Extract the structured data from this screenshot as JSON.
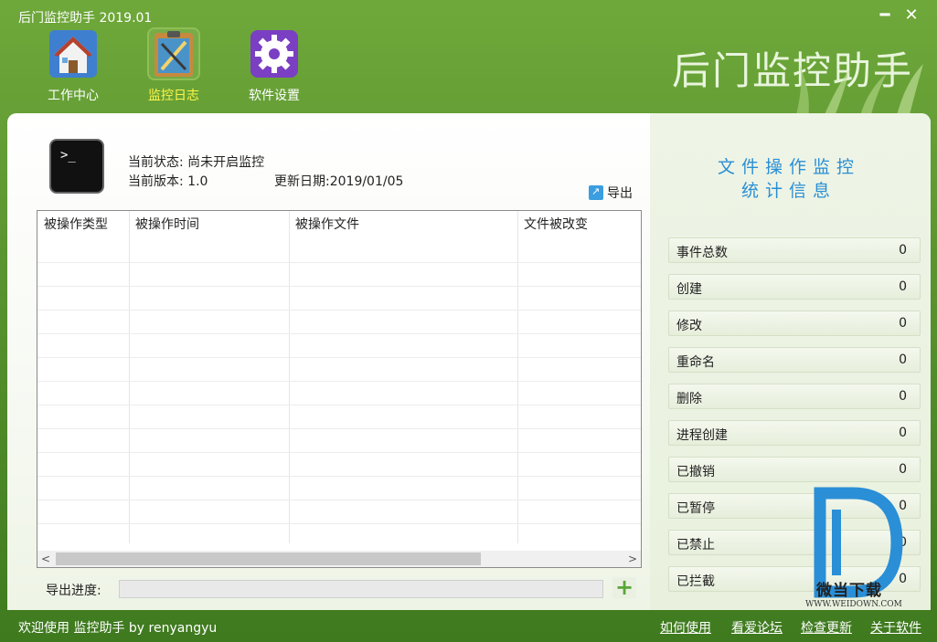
{
  "window": {
    "title": "后门监控助手 2019.01",
    "minimize": "━",
    "close": "✕"
  },
  "nav": [
    {
      "label": "工作中心",
      "icon": "house-icon"
    },
    {
      "label": "监控日志",
      "icon": "clipboard-icon"
    },
    {
      "label": "软件设置",
      "icon": "gear-icon"
    }
  ],
  "brand": "后门监控助手",
  "status": {
    "state": "当前状态: 尚未开启监控",
    "version": "当前版本: 1.0",
    "update": "更新日期:2019/01/05",
    "terminal_glyph": ">_"
  },
  "export_label": "导出",
  "table": {
    "headers": [
      "被操作类型",
      "被操作时间",
      "被操作文件",
      "文件被改变"
    ],
    "rows": []
  },
  "progress": {
    "label": "导出进度:",
    "value": 0
  },
  "plus_glyph": "+",
  "stats": {
    "title_line1": "文件操作监控",
    "title_line2": "统计信息",
    "items": [
      {
        "label": "事件总数",
        "value": "0"
      },
      {
        "label": "创建",
        "value": "0"
      },
      {
        "label": "修改",
        "value": "0"
      },
      {
        "label": "重命名",
        "value": "0"
      },
      {
        "label": "删除",
        "value": "0"
      },
      {
        "label": "进程创建",
        "value": "0"
      },
      {
        "label": "已撤销",
        "value": "0"
      },
      {
        "label": "已暂停",
        "value": "0"
      },
      {
        "label": "已禁止",
        "value": "0"
      },
      {
        "label": "已拦截",
        "value": "0"
      }
    ]
  },
  "watermark": {
    "text": "微当下载",
    "url": "WWW.WEIDOWN.COM"
  },
  "footer": {
    "welcome": "欢迎使用 监控助手  by  renyangyu",
    "links": [
      "如何使用",
      "看爱论坛",
      "检查更新",
      "关于软件"
    ]
  },
  "colors": {
    "accent": "#2a8fd6",
    "active_nav": "#fff64a",
    "header_green": "#5a9530"
  }
}
